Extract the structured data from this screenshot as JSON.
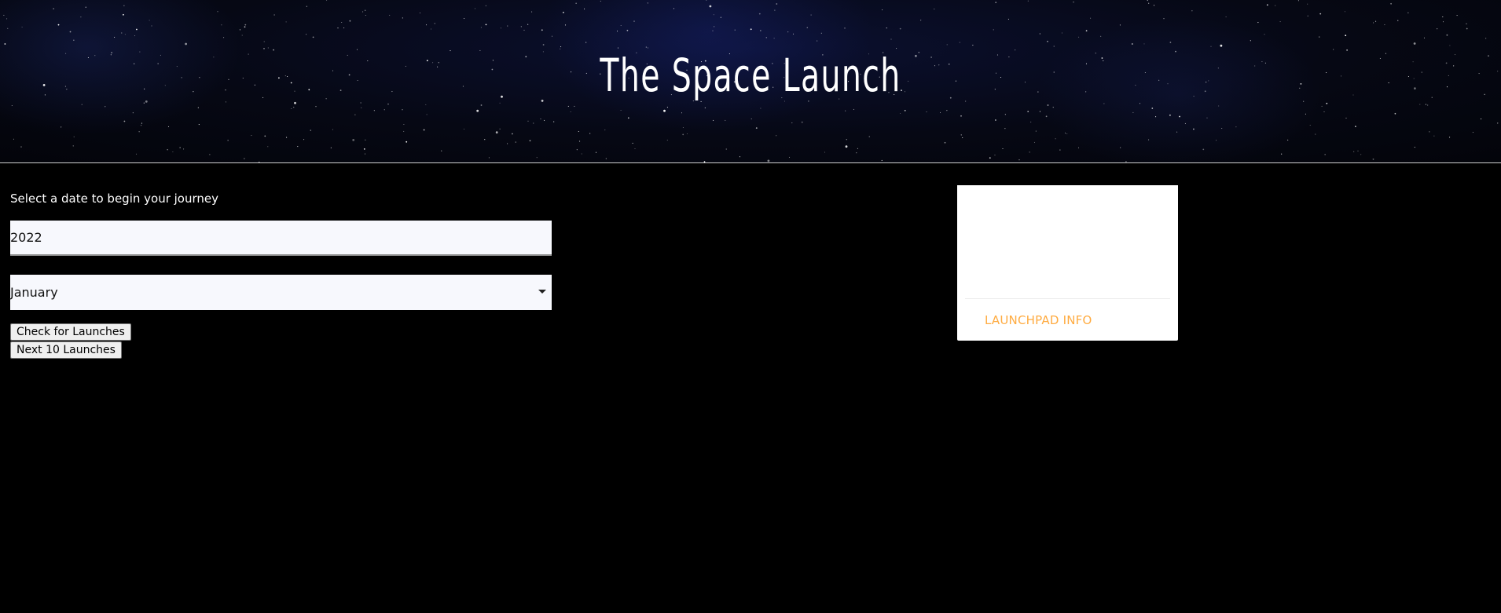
{
  "header": {
    "title": "The Space Launch"
  },
  "form": {
    "prompt": "Select a date to begin your journey",
    "year_value": "2022",
    "month_value": "January",
    "check_button_label": "Check for Launches",
    "next_button_label": "Next 10 Launches"
  },
  "card": {
    "link_label": "LAUNCHPAD INFO"
  },
  "colors": {
    "page_background": "#000000",
    "input_background": "#f7f8fd",
    "card_link": "#ffab40",
    "title_text": "#ffffff"
  },
  "icons": {
    "select_caret": "caret-down-icon"
  }
}
